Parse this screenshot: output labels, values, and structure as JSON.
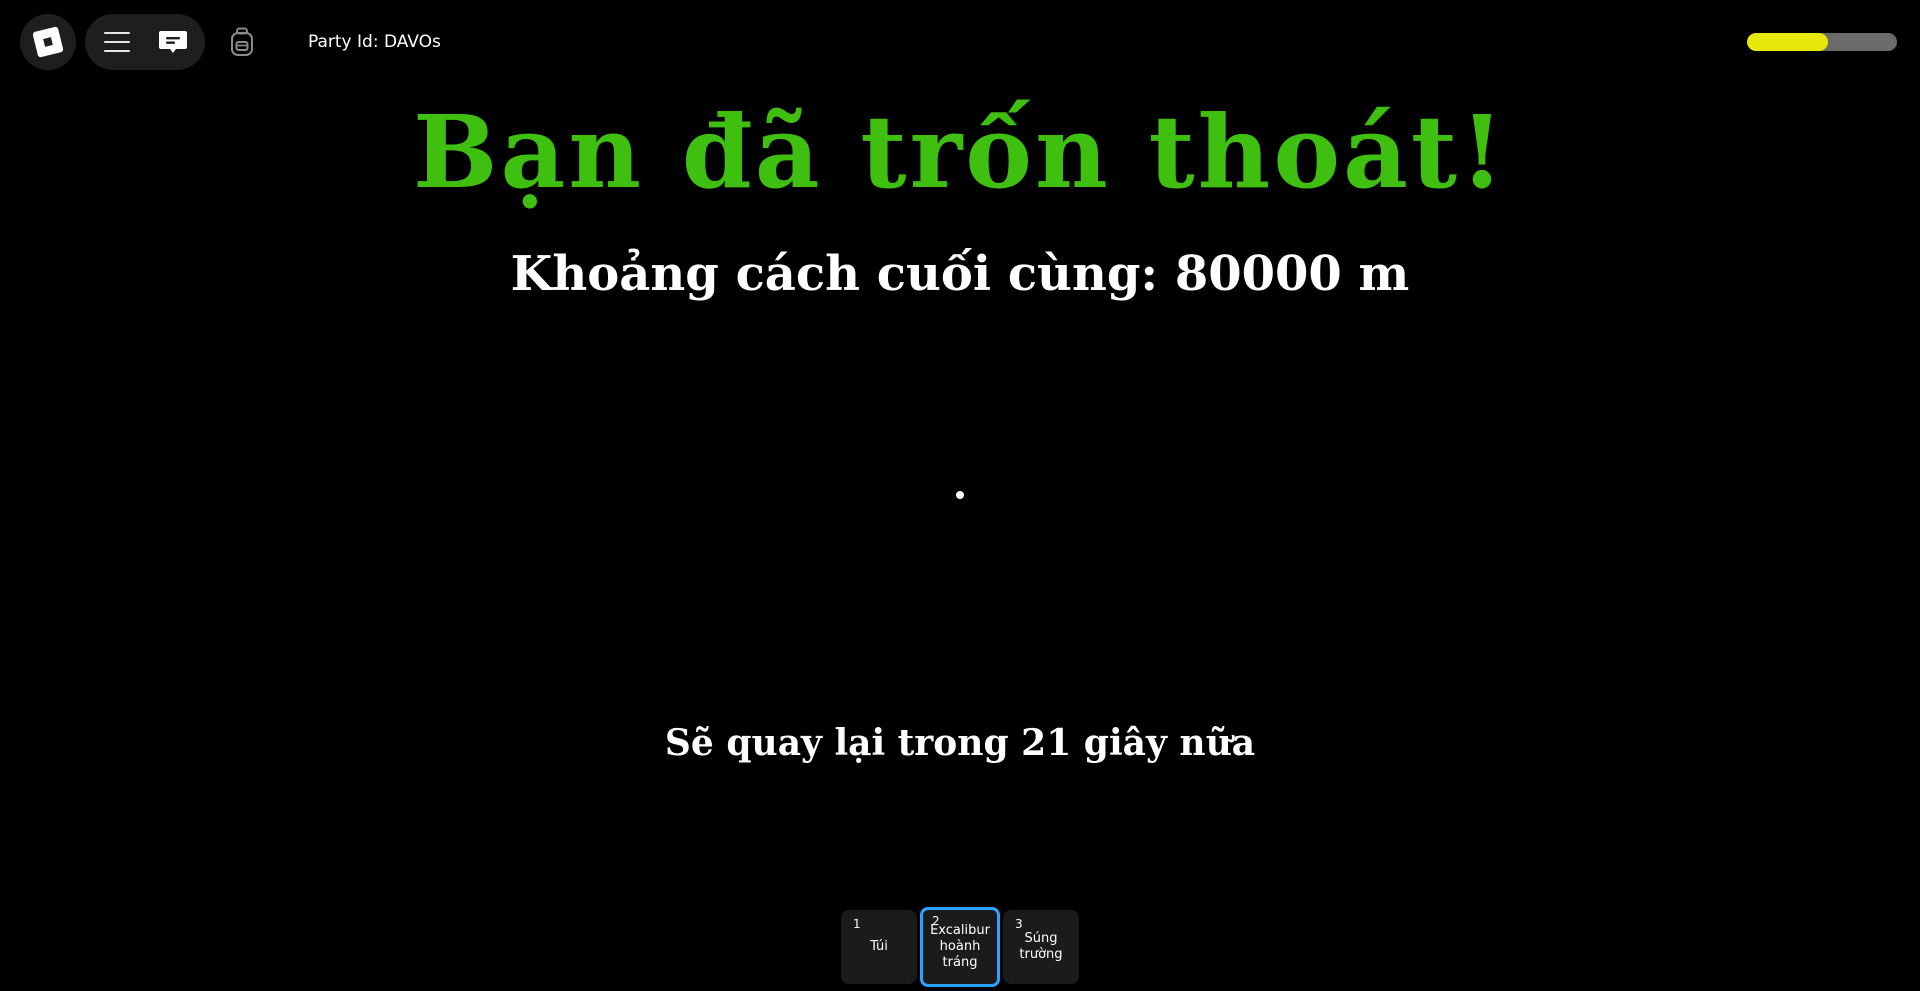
{
  "topbar": {
    "party_id": "Party Id: DAVOs",
    "meter_level": 0.54,
    "meter_color": "#e8e80a",
    "icons": [
      "roblox-logo-icon",
      "hamburger-menu-icon",
      "chat-icon",
      "backpack-icon"
    ]
  },
  "main": {
    "title": "Bạn đã trốn thoát!",
    "title_color": "#3fbf0f",
    "distance": "Khoảng cách cuối cùng: 80000 m",
    "countdown": "Sẽ quay lại trong 21 giây nữa"
  },
  "hotbar": {
    "slots": [
      {
        "number": "1",
        "label": "Túi",
        "selected": false
      },
      {
        "number": "2",
        "label": "Excalibur hoành tráng",
        "selected": true
      },
      {
        "number": "3",
        "label": "Súng trường",
        "selected": false
      }
    ],
    "selected_color": "#2aa4ff"
  }
}
